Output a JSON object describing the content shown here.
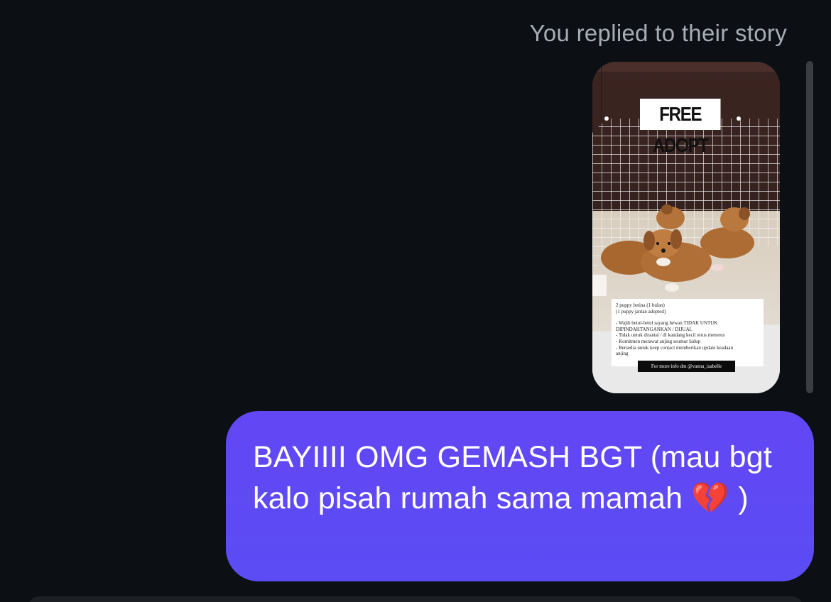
{
  "conversation": {
    "reply_caption": "You replied to their story",
    "story": {
      "headline": "FREE ADOPT",
      "details": [
        "2 puppy betina (1 bulan)",
        "(1 puppy jantan adopted)",
        "",
        "- Wajib betul-betul sayang hewan TIDAK UNTUK",
        "DIPINDAHTANGANKAN / DIJUAL",
        "- Tidak untuk dirantai / di kandang kecil terus menerus",
        "- Komitmen merawat anjing seumur hidup",
        "- Bersedia untuk keep contact memberikan update keadaan",
        "anjing"
      ],
      "contact": "For more info dm @vanna_isabelle"
    },
    "message": {
      "text": "BAYIIII OMG GEMASH BGT (mau bgt kalo pisah rumah sama mamah 💔 )"
    }
  },
  "colors": {
    "background": "#0c1014",
    "bubble": "#6047f4",
    "caption": "#a8adb4"
  }
}
